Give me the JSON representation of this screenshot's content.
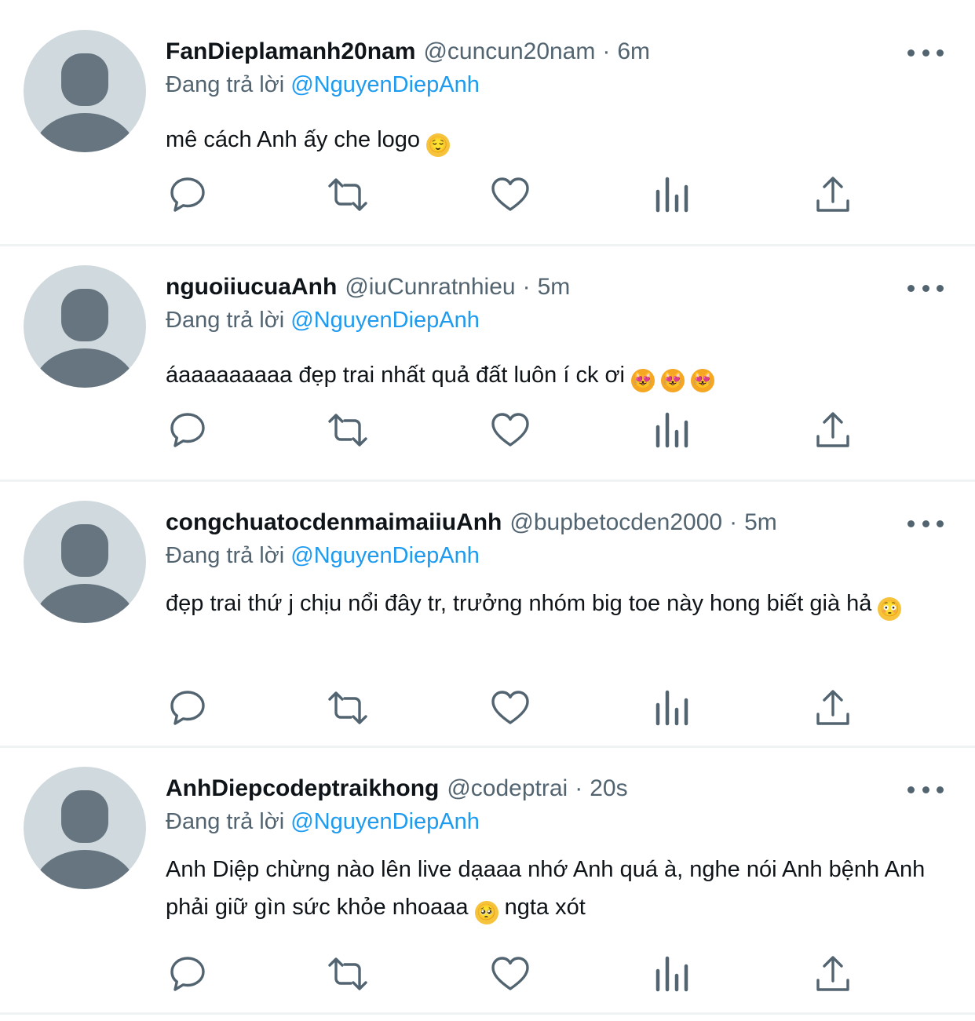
{
  "reply_prefix": "Đang trả lời",
  "colors": {
    "link": "#1d9bf0",
    "secondary": "#536471",
    "divider": "#eff3f4",
    "avatar_bg": "#cfd9de",
    "avatar_fg": "#66757f"
  },
  "icons": {
    "reply": "reply-icon",
    "retweet": "retweet-icon",
    "like": "heart-icon",
    "views": "views-icon",
    "share": "share-icon",
    "more": "more-icon"
  },
  "tweets": [
    {
      "name": "FanDieplamanh20nam",
      "handle": "@cuncun20nam",
      "separator": "·",
      "time": "6m",
      "replying_to": "@NguyenDiepAnh",
      "text": "mê cách Anh ấy che logo",
      "emojis": [
        "😌"
      ]
    },
    {
      "name": "nguoiiucuaAnh",
      "handle": "@iuCunratnhieu",
      "separator": "·",
      "time": "5m",
      "replying_to": "@NguyenDiepAnh",
      "text": "áaaaaaaaaa đẹp trai nhất quả đất luôn í ck ơi",
      "emojis": [
        "😻",
        "😻",
        "😻"
      ]
    },
    {
      "name": "congchuatocdenmaimaiiuAnh",
      "handle": "@bupbetocden2000",
      "separator": "·",
      "time": "5m",
      "replying_to": "@NguyenDiepAnh",
      "text": "đẹp trai thứ j chịu nổi đây tr, trưởng nhóm big toe này hong biết già hả",
      "emojis": [
        "😳"
      ]
    },
    {
      "name": "AnhDiepcodeptraikhong",
      "handle": "@codeptrai",
      "separator": "·",
      "time": "20s",
      "replying_to": "@NguyenDiepAnh",
      "text": "Anh Diệp chừng nào lên live dạaaa nhớ Anh quá à, nghe nói Anh bệnh Anh phải giữ gìn sức khỏe nhoaaa",
      "emojis": [
        "🥺"
      ],
      "text_after": " ngta xót"
    }
  ]
}
